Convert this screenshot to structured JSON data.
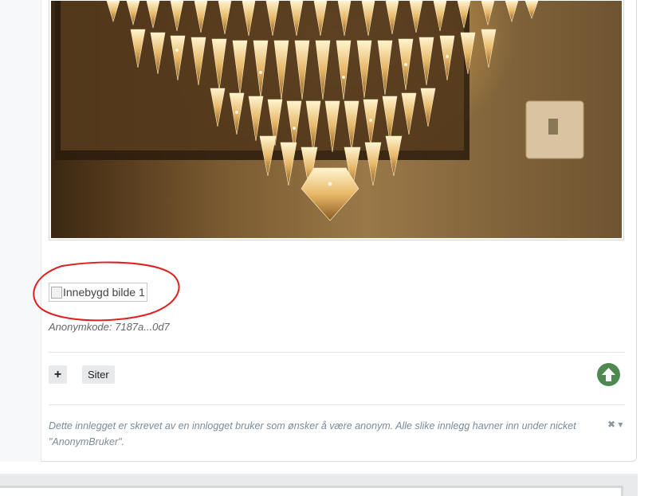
{
  "post": {
    "embedded_image_alt": "Innebygd bilde 1",
    "anonymous_code": "Anonymkode: 7187a...0d7",
    "buttons": {
      "plus": "+",
      "quote": "Siter"
    },
    "disclaimer_line1": "Dette innlegget er skrevet av en innlogget bruker som ønsker å være anonym. Alle slike innlegg havner inn under nicket",
    "disclaimer_line2": "\"AnonymBruker\".",
    "disclaimer_controls": "✖ ▾"
  },
  "colors": {
    "annotation_circle": "#e02020",
    "up_button": "#4e8a4f"
  },
  "icons": {
    "scroll_top": "arrow-up-circle-icon",
    "broken_image": "broken-image-icon"
  }
}
